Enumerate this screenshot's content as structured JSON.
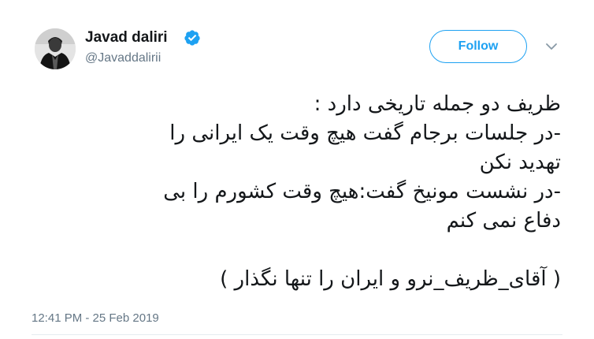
{
  "user": {
    "display_name": "Javad daliri",
    "handle": "@Javaddalirii",
    "verified": true,
    "avatar_icon": "user-avatar-icon"
  },
  "actions": {
    "follow_label": "Follow",
    "menu_icon": "chevron-down-icon"
  },
  "tweet": {
    "lines": [
      "ظریف دو جمله تاریخی دارد :",
      "-در جلسات  برجام گفت هیچ وقت یک ایرانی را",
      "تهدید نکن",
      "-در نشست مونیخ گفت:هیچ وقت کشورم را بی",
      "دفاع نمی کنم",
      "",
      "( آقای_ظریف_نرو و ایران را تنها نگذار )"
    ],
    "timestamp": "12:41 PM - 25 Feb 2019"
  },
  "colors": {
    "accent": "#1da1f2",
    "text": "#14171a",
    "muted": "#657786",
    "divider": "#e6ecf0"
  }
}
